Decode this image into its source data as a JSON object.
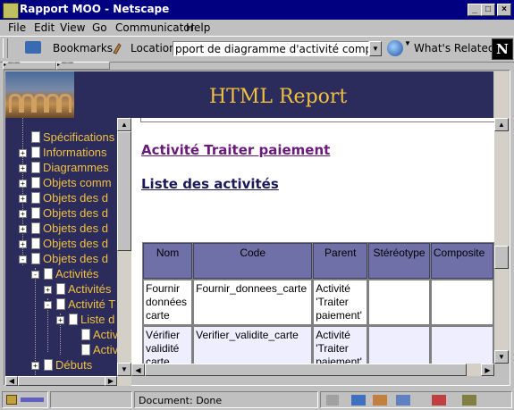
{
  "window": {
    "title": "Rapport MOO - Netscape"
  },
  "menu": [
    "File",
    "Edit",
    "View",
    "Go",
    "Communicator",
    "Help"
  ],
  "toolbar": {
    "bookmarks_label": "Bookmarks",
    "location_label": "Location:",
    "location_value": "pport de diagramme d'activité composite.htm",
    "whats_related_label": "What's Related"
  },
  "banner": {
    "title": "HTML Report"
  },
  "tree": [
    {
      "label": "Spécifications",
      "expander": ""
    },
    {
      "label": "Informations",
      "expander": "+"
    },
    {
      "label": "Diagrammes",
      "expander": "+"
    },
    {
      "label": "Objets comm",
      "expander": "+"
    },
    {
      "label": "Objets des d",
      "expander": "+"
    },
    {
      "label": "Objets des d",
      "expander": "+"
    },
    {
      "label": "Objets des d",
      "expander": "+"
    },
    {
      "label": "Objets des d",
      "expander": "+"
    },
    {
      "label": "Objets des d",
      "expander": "-"
    },
    {
      "label": "Activités",
      "expander": "-"
    },
    {
      "label": "Activités",
      "expander": "+"
    },
    {
      "label": "Activité T",
      "expander": "-"
    },
    {
      "label": "Liste d",
      "expander": "+"
    },
    {
      "label": "Activit",
      "expander": ""
    },
    {
      "label": "Activit",
      "expander": ""
    },
    {
      "label": "Débuts",
      "expander": "+"
    }
  ],
  "content": {
    "heading_activity": "Activité Traiter paiement",
    "heading_list": "Liste des activités",
    "table": {
      "headers": [
        "Nom",
        "Code",
        "Parent",
        "Stéréotype",
        "Composite"
      ],
      "rows": [
        [
          "Fournir données carte",
          "Fournir_donnees_carte",
          "Activité 'Traiter paiement'",
          "",
          ""
        ],
        [
          "Vérifier validité carte",
          "Verifier_validite_carte",
          "Activité 'Traiter paiement'",
          "",
          ""
        ]
      ]
    }
  },
  "status": {
    "text": "Document: Done"
  },
  "colors": {
    "banner_bg": "#2c2c5c",
    "banner_title": "#f0c040",
    "tree_text": "#f0c040",
    "table_header": "#7070a8"
  }
}
